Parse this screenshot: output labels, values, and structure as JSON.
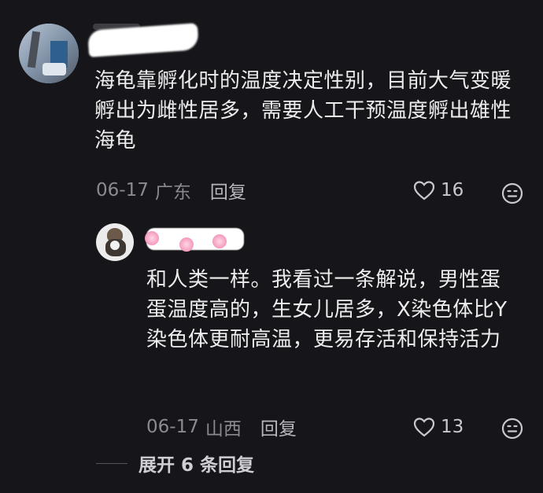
{
  "comment": {
    "text": "海龟靠孵化时的温度决定性别，目前大气变暖孵出为雌性居多，需要人工干预温度孵出雄性海龟",
    "date": "06-17",
    "location": "广东",
    "reply_label": "回复",
    "likes": "16"
  },
  "reply": {
    "text": "和人类一样。我看过一条解说，男性蛋蛋温度高的，生女儿居多，X染色体比Y染色体更耐高温，更易存活和保持活力",
    "date": "06-17",
    "location": "山西",
    "reply_label": "回复",
    "likes": "13"
  },
  "expand_label": "展开 6 条回复"
}
